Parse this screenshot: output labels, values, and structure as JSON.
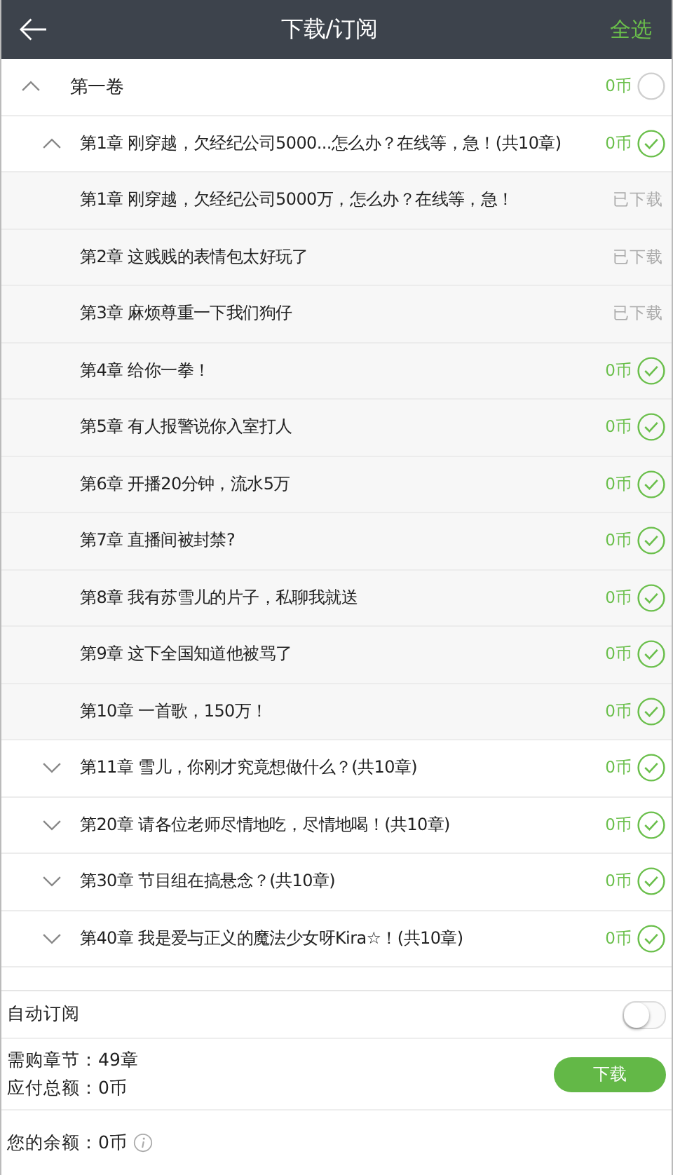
{
  "header": {
    "title": "下载/订阅",
    "action": "全选"
  },
  "volume": {
    "title": "第一卷",
    "expanded": true,
    "price": "0币",
    "selected": false,
    "groups": [
      {
        "title": "第1章 刚穿越，欠经纪公司5000...怎么办？在线等，急！(共10章)",
        "expanded": true,
        "price": "0币",
        "selected": true,
        "chapters": [
          {
            "kind": "downloaded",
            "title": "第1章 刚穿越，欠经纪公司5000万，怎么办？在线等，急！",
            "status": "已下载"
          },
          {
            "kind": "downloaded",
            "title": "第2章 这贱贱的表情包太好玩了",
            "status": "已下载"
          },
          {
            "kind": "downloaded",
            "title": "第3章 麻烦尊重一下我们狗仔",
            "status": "已下载"
          },
          {
            "kind": "paid",
            "title": "第4章 给你一拳！",
            "price": "0币",
            "selected": true
          },
          {
            "kind": "paid",
            "title": "第5章 有人报警说你入室打人",
            "price": "0币",
            "selected": true
          },
          {
            "kind": "paid",
            "title": "第6章 开播20分钟，流水5万",
            "price": "0币",
            "selected": true
          },
          {
            "kind": "paid",
            "title": "第7章 直播间被封禁?",
            "price": "0币",
            "selected": true
          },
          {
            "kind": "paid",
            "title": "第8章 我有苏雪儿的片子，私聊我就送",
            "price": "0币",
            "selected": true
          },
          {
            "kind": "paid",
            "title": "第9章 这下全国知道他被骂了",
            "price": "0币",
            "selected": true
          },
          {
            "kind": "paid",
            "title": "第10章 一首歌，150万！",
            "price": "0币",
            "selected": true
          }
        ]
      },
      {
        "title": "第11章 雪儿，你刚才究竟想做什么？(共10章)",
        "expanded": false,
        "price": "0币",
        "selected": true
      },
      {
        "title": "第20章 请各位老师尽情地吃，尽情地喝！(共10章)",
        "expanded": false,
        "price": "0币",
        "selected": true
      },
      {
        "title": "第30章 节目组在搞悬念？(共10章)",
        "expanded": false,
        "price": "0币",
        "selected": true
      },
      {
        "title": "第40章 我是爱与正义的魔法少女呀Kira☆！(共10章)",
        "expanded": false,
        "price": "0币",
        "selected": true
      }
    ]
  },
  "auto_subscribe": {
    "label": "自动订阅",
    "on": false
  },
  "summary": {
    "chapters": "需购章节：49章",
    "total": "应付总额：0币",
    "button": "下载"
  },
  "balance": {
    "text": "您的余额：0币"
  }
}
